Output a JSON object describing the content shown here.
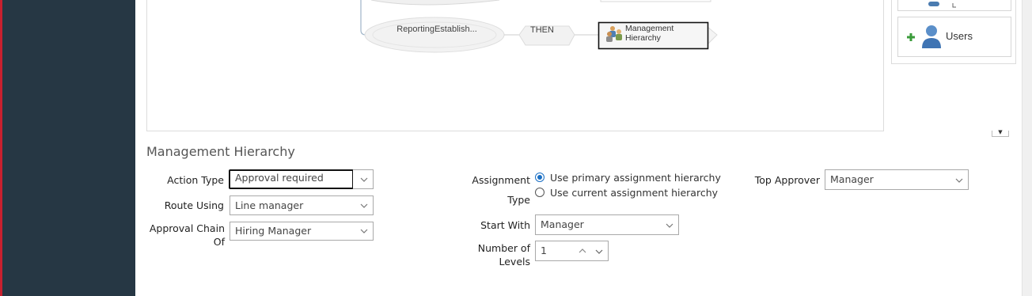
{
  "diagram": {
    "condition_node": "ReportingEstablish...",
    "then_label": "THEN",
    "action_node_line1": "Management",
    "action_node_line2": "Hierarchy"
  },
  "palette": {
    "users_label": "Users"
  },
  "section": {
    "title": "Management Hierarchy"
  },
  "form": {
    "action_type": {
      "label": "Action Type",
      "value": "Approval required"
    },
    "route_using": {
      "label": "Route Using",
      "value": "Line manager"
    },
    "approval_chain_of": {
      "label_line1": "Approval Chain",
      "label_line2": "Of",
      "value": "Hiring Manager"
    },
    "assignment_type": {
      "label_line1": "Assignment",
      "label_line2": "Type",
      "options": [
        {
          "label": "Use primary assignment hierarchy",
          "selected": true
        },
        {
          "label": "Use current assignment hierarchy",
          "selected": false
        }
      ]
    },
    "start_with": {
      "label": "Start With",
      "value": "Manager"
    },
    "number_of_levels": {
      "label_line1": "Number of",
      "label_line2": "Levels",
      "value": "1"
    },
    "top_approver": {
      "label": "Top Approver",
      "value": "Manager"
    }
  },
  "colors": {
    "nav_background": "#263744",
    "accent_red": "#c8202f",
    "radio_selected": "#1a6fc4"
  }
}
